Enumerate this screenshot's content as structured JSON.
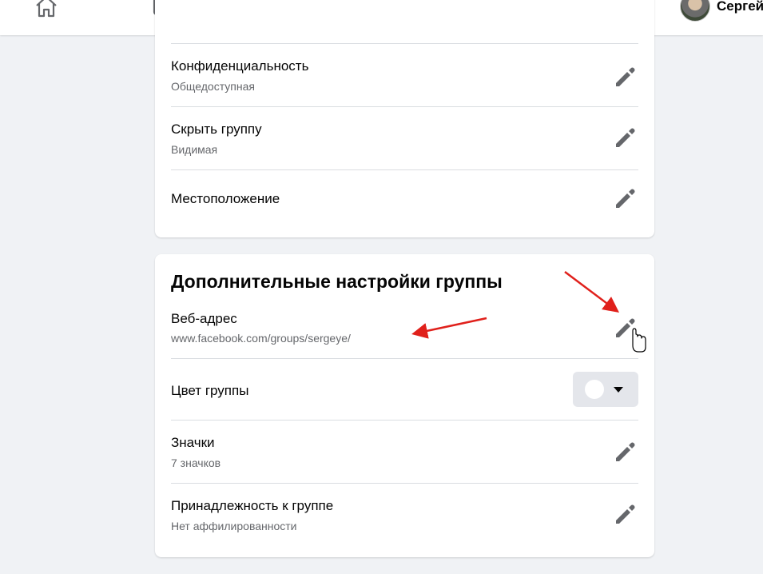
{
  "topbar": {
    "nav_icons": [
      "home-icon",
      "watch-icon",
      "groups-icon",
      "gaming-icon"
    ],
    "profile_name": "Сергей"
  },
  "privacy_card": {
    "rows": [
      {
        "title": "Конфиденциальность",
        "subtitle": "Общедоступная"
      },
      {
        "title": "Скрыть группу",
        "subtitle": "Видимая"
      },
      {
        "title": "Местоположение"
      }
    ]
  },
  "advanced_card": {
    "title": "Дополнительные настройки группы",
    "web_address": {
      "title": "Веб-адрес",
      "subtitle": "www.facebook.com/groups/sergeye/"
    },
    "group_color": {
      "title": "Цвет группы",
      "value_color": "#ffffff"
    },
    "badges": {
      "title": "Значки",
      "subtitle": "7 значков"
    },
    "affiliation": {
      "title": "Принадлежность к группе",
      "subtitle": "Нет аффилированности"
    }
  },
  "colors": {
    "accent_red": "#e41e3f",
    "annotation_arrow": "#e0201b",
    "icon_gray": "#65676b"
  }
}
